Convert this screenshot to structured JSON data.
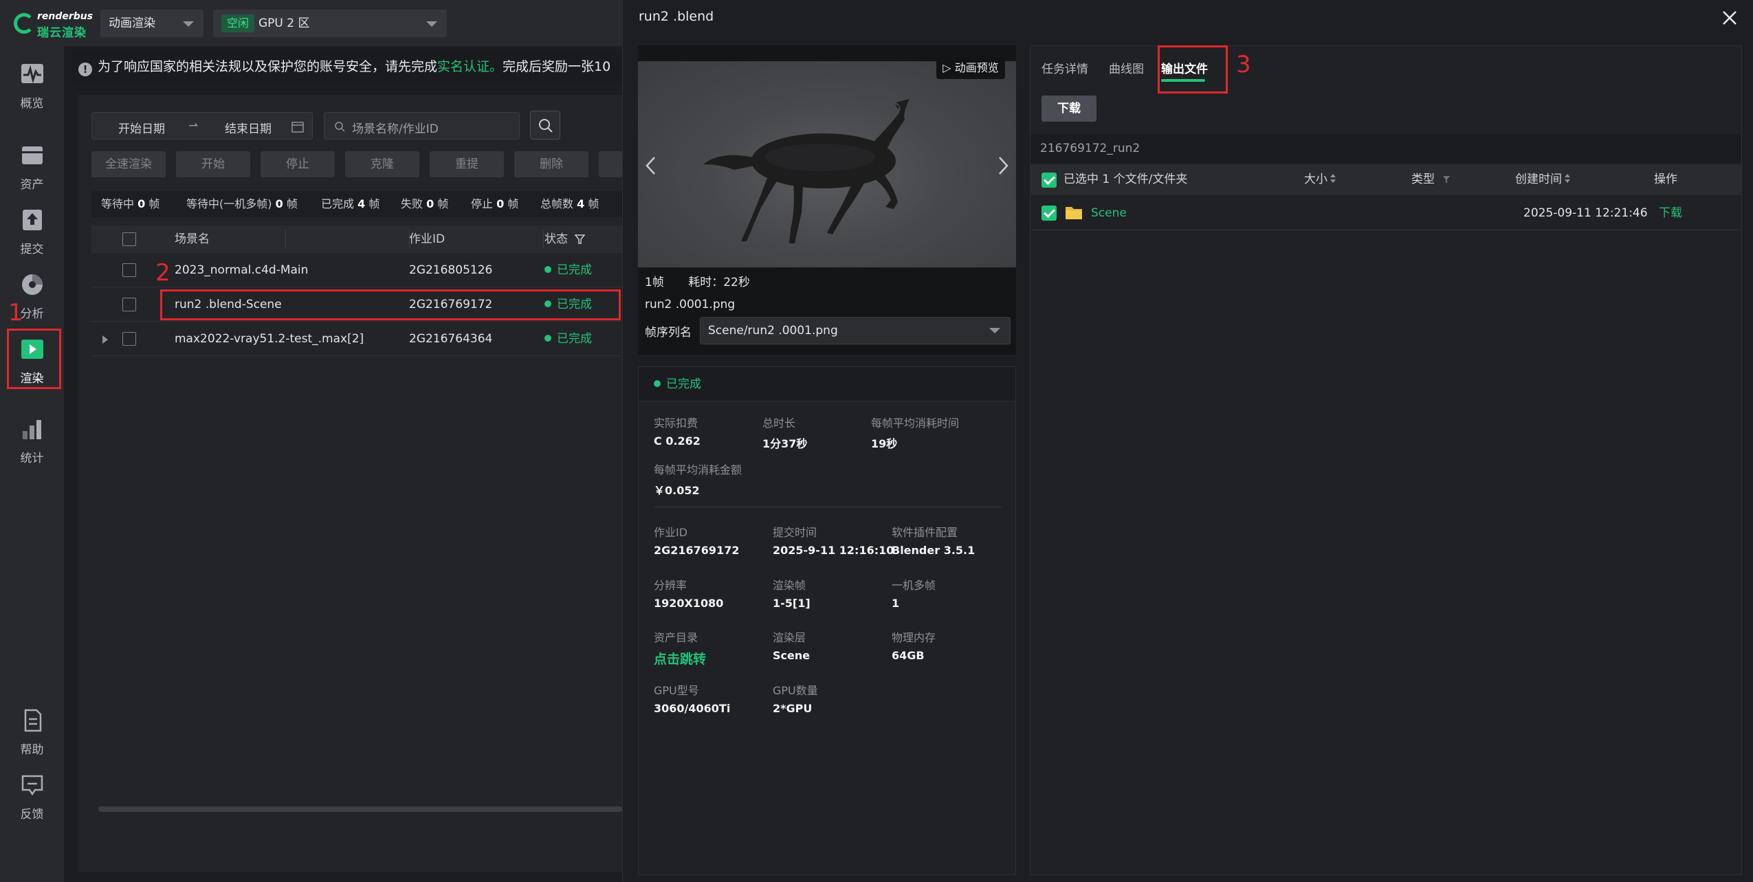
{
  "logo": {
    "brand_en": "renderbus",
    "brand_cn": "瑞云渲染"
  },
  "topbar": {
    "mode_select": "动画渲染",
    "gpu_tag": "空闲",
    "gpu_zone": "GPU 2 区"
  },
  "sidebar": {
    "items": [
      {
        "label": "概览",
        "icon": "pulse-icon"
      },
      {
        "label": "资产",
        "icon": "folder-icon"
      },
      {
        "label": "提交",
        "icon": "upload-icon"
      },
      {
        "label": "分析",
        "icon": "pie-icon"
      },
      {
        "label": "渲染",
        "icon": "play-icon"
      },
      {
        "label": "统计",
        "icon": "bar-icon"
      },
      {
        "label": "帮助",
        "icon": "doc-icon"
      },
      {
        "label": "反馈",
        "icon": "feedback-icon"
      }
    ]
  },
  "annotations": [
    "1",
    "2",
    "3"
  ],
  "notice": {
    "text": "为了响应国家的相关法规以及保护您的账号安全，请先完成",
    "link": "实名认证。",
    "tail": "完成后奖励一张10"
  },
  "filters": {
    "start_date": "开始日期",
    "end_date": "结束日期",
    "search_placeholder": "场景名称/作业ID"
  },
  "actions": [
    "全速渲染",
    "开始",
    "停止",
    "克隆",
    "重提",
    "删除"
  ],
  "stats": [
    {
      "label": "等待中",
      "value": "0",
      "unit": "帧"
    },
    {
      "label": "等待中(一机多帧)",
      "value": "0",
      "unit": "帧"
    },
    {
      "label": "已完成",
      "value": "4",
      "unit": "帧"
    },
    {
      "label": "失败",
      "value": "0",
      "unit": "帧"
    },
    {
      "label": "停止",
      "value": "0",
      "unit": "帧"
    },
    {
      "label": "总帧数",
      "value": "4",
      "unit": "帧"
    }
  ],
  "table": {
    "headers": {
      "name": "场景名",
      "id": "作业ID",
      "status": "状态"
    },
    "rows": [
      {
        "name": "2023_normal.c4d-Main",
        "id": "2G216805126",
        "status": "已完成"
      },
      {
        "name": "run2 .blend-Scene",
        "id": "2G216769172",
        "status": "已完成"
      },
      {
        "name": "max2022-vray51.2-test_.max[2]",
        "id": "2G216764364",
        "status": "已完成"
      }
    ]
  },
  "drawer": {
    "title": "run2 .blend",
    "preview": {
      "anim_label": "动画预览",
      "frames": "1帧",
      "time": "耗时：22秒",
      "file": "run2 .0001.png",
      "seq_label": "帧序列名",
      "seq_value": "Scene/run2 .0001.png"
    },
    "info": {
      "status": "已完成",
      "fields": [
        {
          "k": "实际扣费",
          "v": "C 0.262"
        },
        {
          "k": "总时长",
          "v": "1分37秒"
        },
        {
          "k": "每帧平均消耗时间",
          "v": "19秒"
        },
        {
          "k": "每帧平均消耗金额",
          "v": "￥0.052"
        },
        {
          "k": "作业ID",
          "v": "2G216769172"
        },
        {
          "k": "提交时间",
          "v": "2025-9-11 12:16:10"
        },
        {
          "k": "软件插件配置",
          "v": "Blender 3.5.1"
        },
        {
          "k": "分辨率",
          "v": "1920X1080"
        },
        {
          "k": "渲染帧",
          "v": "1-5[1]"
        },
        {
          "k": "一机多帧",
          "v": "1"
        },
        {
          "k": "资产目录",
          "v": "点击跳转"
        },
        {
          "k": "渲染层",
          "v": "Scene"
        },
        {
          "k": "物理内存",
          "v": "64GB"
        },
        {
          "k": "GPU型号",
          "v": "3060/4060Ti"
        },
        {
          "k": "GPU数量",
          "v": "2*GPU"
        }
      ]
    },
    "tabs": [
      "任务详情",
      "曲线图",
      "输出文件"
    ],
    "download_label": "下载",
    "path": "216769172_run2",
    "files": {
      "selected_text": "已选中 1 个文件/文件夹",
      "headers": {
        "size": "大小",
        "type": "类型",
        "created": "创建时间",
        "action": "操作"
      },
      "rows": [
        {
          "name": "Scene",
          "created": "2025-09-11 12:21:46",
          "action": "下载"
        }
      ]
    }
  },
  "colors": {
    "accent": "#22c27a",
    "annotation": "#e0282c",
    "background": "#1c1d20"
  }
}
